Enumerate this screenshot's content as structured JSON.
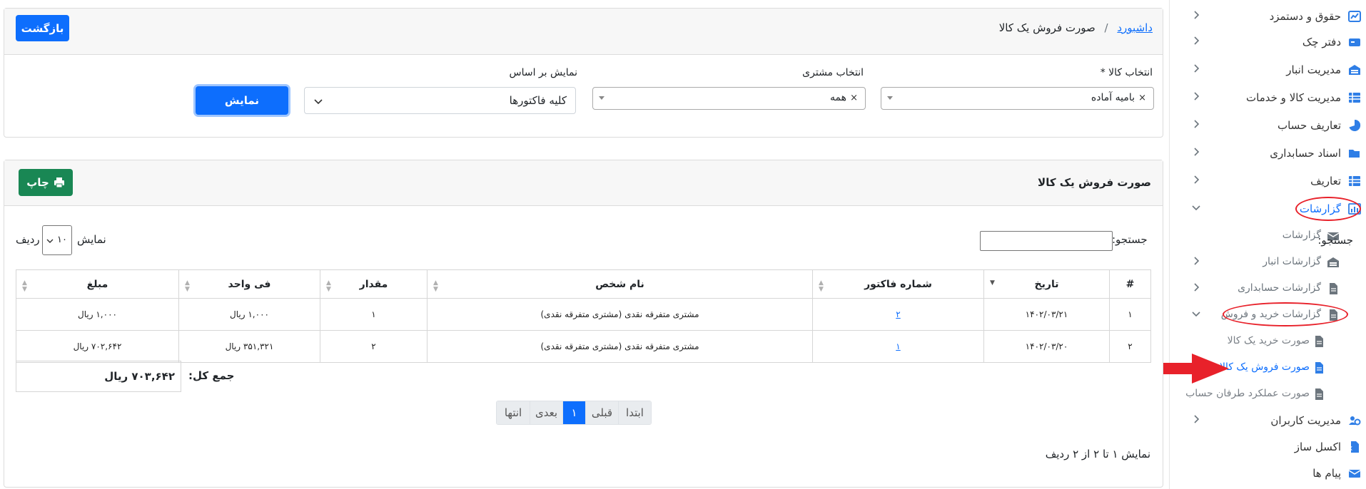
{
  "sidebar": {
    "items": [
      {
        "label": "حقوق و دستمزد",
        "icon": "chart-line-icon",
        "level": 1,
        "chevron": "left"
      },
      {
        "label": "دفتر چک",
        "icon": "money-check-icon",
        "level": 1,
        "chevron": "left"
      },
      {
        "label": "مدیریت انبار",
        "icon": "warehouse-icon",
        "level": 1,
        "chevron": "left"
      },
      {
        "label": "مدیریت کالا و خدمات",
        "icon": "table-list-icon",
        "level": 1,
        "chevron": "left"
      },
      {
        "label": "تعاریف حساب",
        "icon": "pie-chart-icon",
        "level": 1,
        "chevron": "left"
      },
      {
        "label": "اسناد حسابداری",
        "icon": "folder-open-icon",
        "level": 1,
        "chevron": "left"
      },
      {
        "label": "تعاریف",
        "icon": "table-list-icon",
        "level": 1,
        "chevron": "left"
      },
      {
        "label": "گزارشات",
        "icon": "report-chart-icon",
        "level": 1,
        "chevron": "down",
        "active": true
      },
      {
        "label": "گزارشات",
        "icon": "envelope-icon",
        "level": 2,
        "chevron": ""
      },
      {
        "label": "گزارشات انبار",
        "icon": "warehouse-icon",
        "level": 2,
        "chevron": "left"
      },
      {
        "label": "گزارشات حسابداری",
        "icon": "file-icon",
        "level": 2,
        "chevron": "left"
      },
      {
        "label": "گزارشات خرید و فروش",
        "icon": "file-icon",
        "level": 2,
        "chevron": "down"
      },
      {
        "label": "صورت خرید یک کالا",
        "icon": "file-icon",
        "level": 3,
        "chevron": ""
      },
      {
        "label": "صورت فروش یک کالا",
        "icon": "file-icon",
        "level": 3,
        "chevron": "",
        "active": true
      },
      {
        "label": "صورت عملکرد طرفان حساب",
        "icon": "file-icon",
        "level": 3,
        "chevron": ""
      },
      {
        "label": "مدیریت کاربران",
        "icon": "users-gear-icon",
        "level": 1,
        "chevron": "left"
      },
      {
        "label": "اکسل ساز",
        "icon": "excel-file-icon",
        "level": 1,
        "chevron": ""
      },
      {
        "label": "پیام ها",
        "icon": "envelope-icon",
        "level": 1,
        "chevron": ""
      }
    ]
  },
  "header": {
    "breadcrumb_home": "داشبورد",
    "breadcrumb_sep": "/",
    "breadcrumb_current": "صورت فروش یک کالا",
    "back_button": "بازگشت"
  },
  "filters": {
    "product_label": "انتخاب کالا *",
    "product_value": "بامیه آماده",
    "customer_label": "انتخاب مشتری",
    "customer_value": "همه",
    "show_by_label": "نمایش بر اساس",
    "show_by_value": "کلیه فاکتورها",
    "show_button": "نمایش",
    "clear_glyph": "×"
  },
  "report": {
    "title": "صورت فروش یک کالا",
    "print_button": "چاپ",
    "search_label": "جستجو:",
    "search_value": "",
    "length_prefix": "نمایش",
    "length_value": "۱۰",
    "length_suffix": "ردیف",
    "columns": [
      "#",
      "تاریخ",
      "شماره فاکتور",
      "نام شخص",
      "مقدار",
      "فی واحد",
      "مبلغ"
    ],
    "rows": [
      {
        "num": "۱",
        "date": "۱۴۰۲/۰۳/۲۱",
        "invoice": "۲",
        "person": "مشتری متفرقه نقدی (مشتری متفرقه نقدی)",
        "qty": "۱",
        "unit_price": "۱,۰۰۰ ریال",
        "amount": "۱,۰۰۰ ریال"
      },
      {
        "num": "۲",
        "date": "۱۴۰۲/۰۳/۲۰",
        "invoice": "۱",
        "person": "مشتری متفرقه نقدی (مشتری متفرقه نقدی)",
        "qty": "۲",
        "unit_price": "۳۵۱,۳۲۱ ریال",
        "amount": "۷۰۲,۶۴۲ ریال"
      }
    ],
    "total_label": "جمع کل:",
    "total_value": "۷۰۳,۶۴۲ ریال",
    "pagination": {
      "first": "ابتدا",
      "prev": "قبلی",
      "current": "۱",
      "next": "بعدی",
      "last": "انتها"
    },
    "info": "نمایش ۱ تا ۲ از ۲ ردیف"
  },
  "colors": {
    "primary": "#0d6efd",
    "success": "#198754",
    "annotation_red": "#e8212a"
  }
}
